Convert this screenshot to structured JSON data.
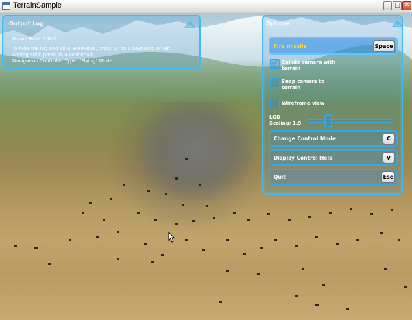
{
  "window": {
    "title": "TerrainSample",
    "minimize_glyph": "_",
    "maximize_glyph": "□",
    "close_glyph": "✕"
  },
  "output_log": {
    "title": "Output Log",
    "lines": [
      "Frame Rate: 100.0",
      "To hide the log and all UI elements, press 'Z' on a keyboard or left",
      "analog stick press on a Gamepad.",
      "Navigation Controller Type: \"Flying\" Mode"
    ]
  },
  "options": {
    "title": "Options",
    "fire_missile": {
      "label": "Fire missile",
      "key": "Space"
    },
    "collide_camera": {
      "label_line1": "Collide camera with",
      "label_line2": "terrain",
      "checked": true
    },
    "snap_camera": {
      "label_line1": "Snap camera to",
      "label_line2": "terrain",
      "checked": false
    },
    "wireframe": {
      "label": "Wireframe view",
      "checked": false
    },
    "lod": {
      "label": "LOD",
      "scaling_label": "Scaling: 1.9",
      "value": 1.9,
      "fraction": 0.22
    },
    "change_control_mode": {
      "label": "Change Control Mode",
      "key": "C"
    },
    "display_control_help": {
      "label": "Display Control Help",
      "key": "V"
    },
    "quit": {
      "label": "Quit",
      "key": "Esc"
    }
  },
  "colors": {
    "panel_border": "#46b8f0",
    "hot_text": "#ffd23a",
    "check_color": "#39b1ff"
  },
  "icons": {
    "collapse": "triangle-up-icon",
    "app": "window-icon"
  }
}
